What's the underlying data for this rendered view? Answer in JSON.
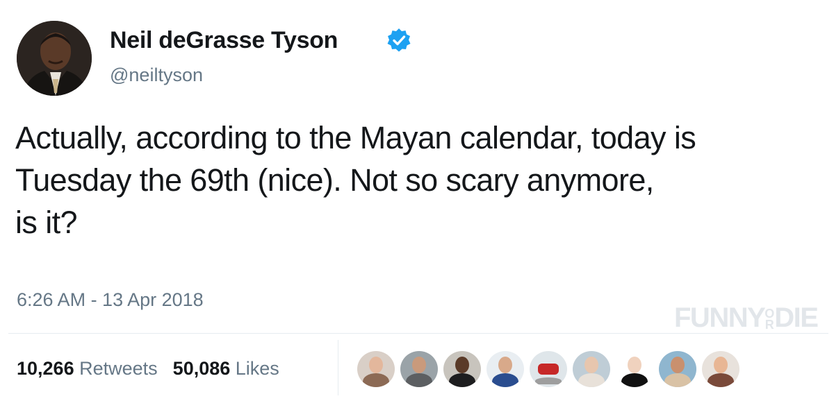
{
  "author": {
    "name": "Neil deGrasse Tyson",
    "handle": "@neiltyson",
    "verified": true
  },
  "tweet": {
    "text_lines": [
      "Actually, according to the Mayan calendar, today is",
      "Tuesday the 69th (nice). Not so scary anymore,",
      "is it?"
    ],
    "timestamp": "6:26 AM - 13 Apr 2018"
  },
  "stats": {
    "retweets_count": "10,266",
    "retweets_label": "Retweets",
    "likes_count": "50,086",
    "likes_label": "Likes"
  },
  "watermark": "FUNNY OR DIE",
  "colors": {
    "text": "#14171a",
    "secondary": "#657786",
    "verified_blue": "#1da1f2",
    "divider": "#e6ecf0"
  },
  "icons": {
    "verified": "verified-badge-icon"
  }
}
